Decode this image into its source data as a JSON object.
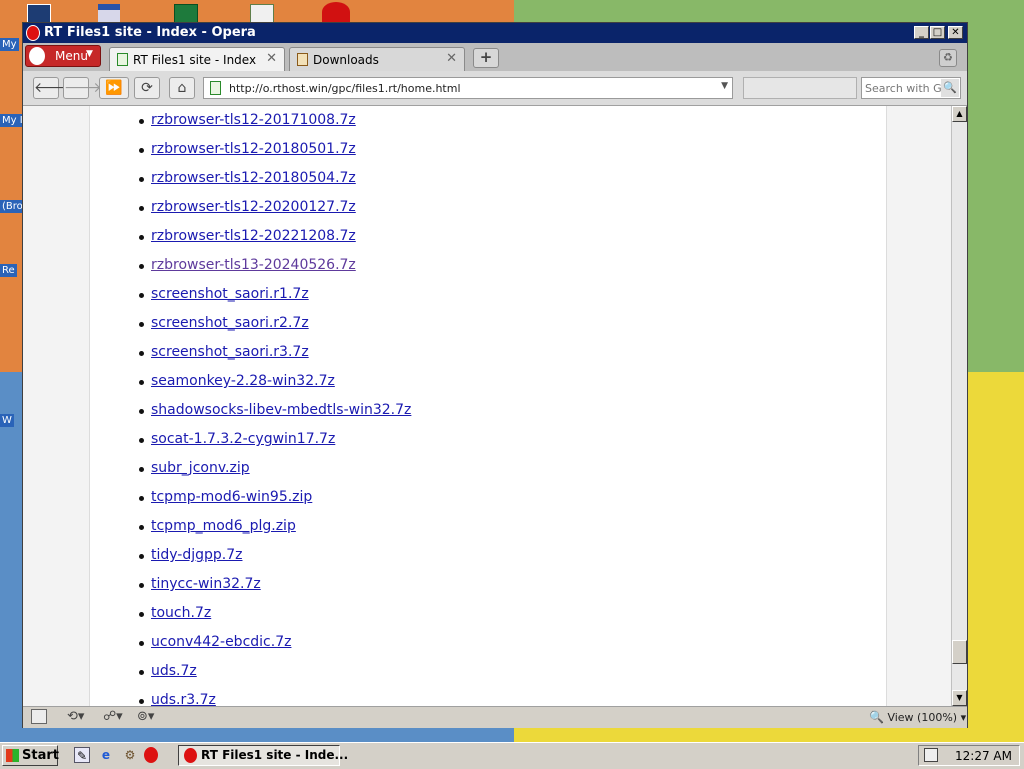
{
  "desktop": {
    "labels": [
      "My",
      "My I",
      "(Bro",
      "Re",
      "W"
    ]
  },
  "window": {
    "title": "RT Files1 site - Index - Opera",
    "buttons": {
      "minimize": "_",
      "maximize": "□",
      "close": "✕"
    }
  },
  "tabs": {
    "menu_label": "Menu",
    "active": {
      "label": "RT Files1 site - Index",
      "close": "✕"
    },
    "inactive": {
      "label": "Downloads",
      "close": "✕"
    },
    "new_tab": "+"
  },
  "nav": {
    "back": "🡐",
    "forward": "🡒",
    "fast_forward": "⏩",
    "reload": "⟳",
    "home": "⌂",
    "url": "http://o.rthost.win/gpc/files1.rt/home.html",
    "search_placeholder": "Search with Google",
    "search_button": "🔍"
  },
  "files": [
    {
      "name": "rzbrowser-tls12-20171008.7z",
      "visited": false
    },
    {
      "name": "rzbrowser-tls12-20180501.7z",
      "visited": false
    },
    {
      "name": "rzbrowser-tls12-20180504.7z",
      "visited": false
    },
    {
      "name": "rzbrowser-tls12-20200127.7z",
      "visited": false
    },
    {
      "name": "rzbrowser-tls12-20221208.7z",
      "visited": false
    },
    {
      "name": "rzbrowser-tls13-20240526.7z",
      "visited": true
    },
    {
      "name": "screenshot_saori.r1.7z",
      "visited": false
    },
    {
      "name": "screenshot_saori.r2.7z",
      "visited": false
    },
    {
      "name": "screenshot_saori.r3.7z",
      "visited": false
    },
    {
      "name": "seamonkey-2.28-win32.7z",
      "visited": false
    },
    {
      "name": "shadowsocks-libev-mbedtls-win32.7z",
      "visited": false
    },
    {
      "name": "socat-1.7.3.2-cygwin17.7z",
      "visited": false
    },
    {
      "name": "subr_jconv.zip",
      "visited": false
    },
    {
      "name": "tcpmp-mod6-win95.zip",
      "visited": false
    },
    {
      "name": "tcpmp_mod6_plg.zip",
      "visited": false
    },
    {
      "name": "tidy-djgpp.7z",
      "visited": false
    },
    {
      "name": "tinycc-win32.7z",
      "visited": false
    },
    {
      "name": "touch.7z",
      "visited": false
    },
    {
      "name": "uconv442-ebcdic.7z",
      "visited": false
    },
    {
      "name": "uds.7z",
      "visited": false
    },
    {
      "name": "uds.r3.7z",
      "visited": false
    }
  ],
  "status": {
    "zoom": "View (100%)"
  },
  "taskbar": {
    "start_label": "Start",
    "task_label": "RT Files1 site - Inde...",
    "clock": "12:27 AM"
  },
  "colors": {
    "link": "#1a1ab0",
    "visited": "#5e3a9c",
    "titlebar": "#0a246a",
    "opera_red": "#c62828"
  }
}
